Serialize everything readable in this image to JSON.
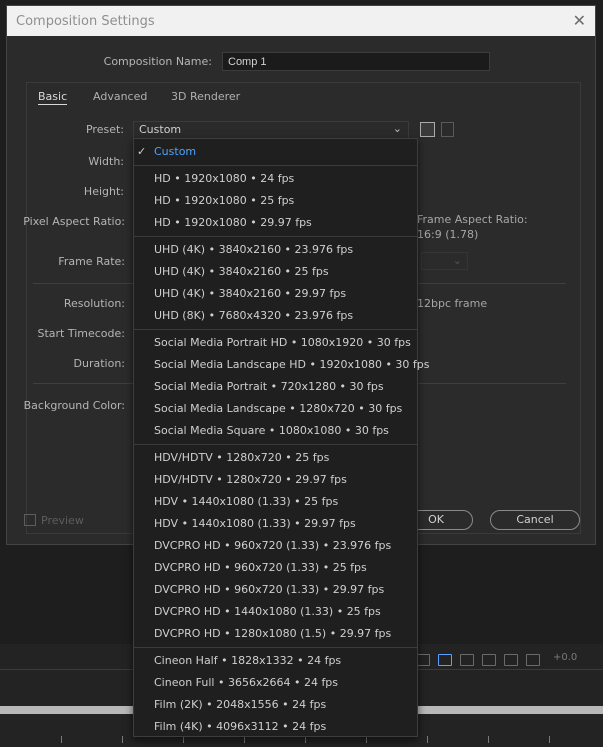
{
  "dialog": {
    "title": "Composition Settings",
    "close_glyph": "✕"
  },
  "composition": {
    "name_label": "Composition Name:",
    "name_value": "Comp 1"
  },
  "tabs": [
    {
      "label": "Basic",
      "active": true
    },
    {
      "label": "Advanced",
      "active": false
    },
    {
      "label": "3D Renderer",
      "active": false
    }
  ],
  "preset": {
    "label": "Preset:",
    "value": "Custom"
  },
  "labels": {
    "width": "Width:",
    "height": "Height:",
    "pixel_aspect": "Pixel Aspect Ratio:",
    "frame_rate": "Frame Rate:",
    "resolution": "Resolution:",
    "start_timecode": "Start Timecode:",
    "duration": "Duration:",
    "background_color": "Background Color:"
  },
  "frame_aspect": {
    "label": "Frame Aspect Ratio:",
    "value": "16:9 (1.78)"
  },
  "resolution_info": "12bpc frame",
  "preview_label": "Preview",
  "buttons": {
    "ok": "OK",
    "cancel": "Cancel"
  },
  "dropdown": {
    "groups": [
      [
        "Custom"
      ],
      [
        "HD  •  1920x1080 • 24 fps",
        "HD  •  1920x1080 • 25 fps",
        "HD  •  1920x1080 • 29.97 fps"
      ],
      [
        "UHD (4K)  •  3840x2160 • 23.976 fps",
        "UHD (4K)  •  3840x2160 • 25 fps",
        "UHD (4K)  •  3840x2160 • 29.97 fps",
        "UHD (8K)  •  7680x4320 • 23.976 fps"
      ],
      [
        "Social Media Portrait HD  •  1080x1920 • 30 fps",
        "Social Media Landscape HD  •  1920x1080 • 30 fps",
        "Social Media Portrait  •  720x1280 • 30 fps",
        "Social Media Landscape  •  1280x720 • 30 fps",
        "Social Media Square  •  1080x1080 • 30 fps"
      ],
      [
        "HDV/HDTV  •  1280x720 • 25 fps",
        "HDV/HDTV  •  1280x720 • 29.97 fps",
        "HDV  •  1440x1080 (1.33) • 25 fps",
        "HDV  •  1440x1080 (1.33) • 29.97 fps",
        "DVCPRO HD  •  960x720 (1.33) • 23.976 fps",
        "DVCPRO HD  •  960x720 (1.33) • 25 fps",
        "DVCPRO HD  •  960x720 (1.33) • 29.97 fps",
        "DVCPRO HD  •  1440x1080 (1.33) • 25 fps",
        "DVCPRO HD  •  1280x1080 (1.5) • 29.97 fps"
      ],
      [
        "Cineon Half  •  1828x1332 • 24 fps",
        "Cineon Full  •  3656x2664 • 24 fps",
        "Film (2K)  •  2048x1556 • 24 fps",
        "Film (4K)  •  4096x3112 • 24 fps"
      ]
    ],
    "selected": "Custom",
    "selected_color": "#4ba3ff"
  },
  "app": {
    "offset_readout": "+0.0"
  }
}
